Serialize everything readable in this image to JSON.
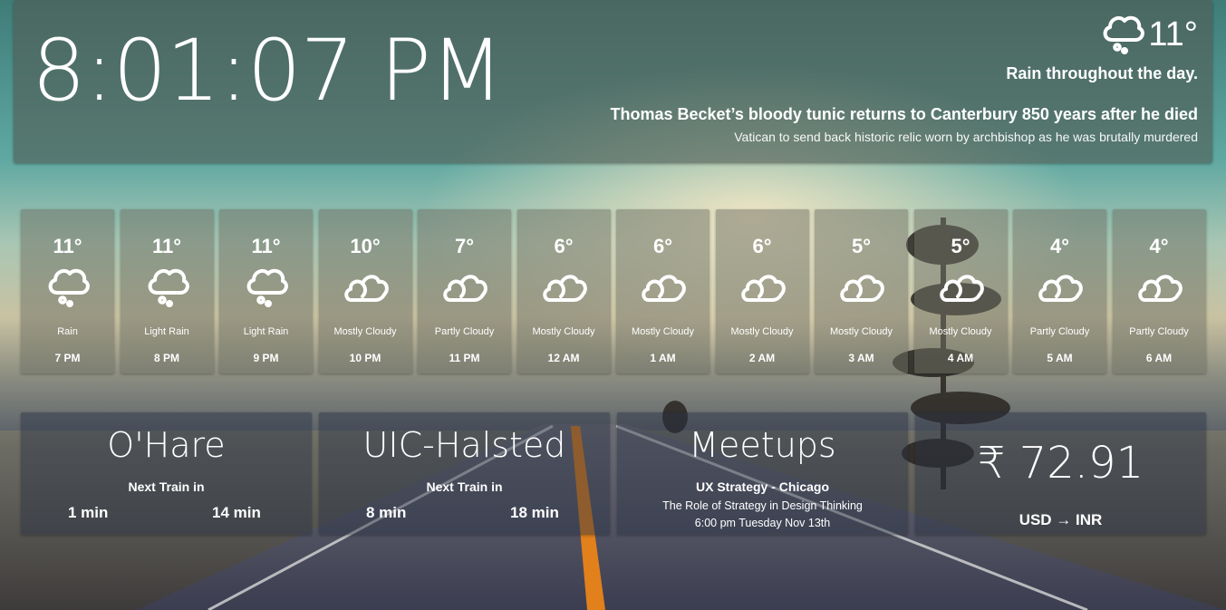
{
  "clock": {
    "time": "8:01:07 PM"
  },
  "current_weather": {
    "icon": "rain-cloud-icon",
    "temp": "11°",
    "summary": "Rain throughout the day."
  },
  "news": {
    "headline": "Thomas Becket’s bloody tunic returns to Canterbury 850 years after he died",
    "subhead": "Vatican to send back historic relic worn by archbishop as he was brutally murdered"
  },
  "hourly": [
    {
      "temp": "11°",
      "condition": "Rain",
      "hour": "7 PM",
      "icon": "rain-cloud-icon"
    },
    {
      "temp": "11°",
      "condition": "Light Rain",
      "hour": "8 PM",
      "icon": "rain-cloud-icon"
    },
    {
      "temp": "11°",
      "condition": "Light Rain",
      "hour": "9 PM",
      "icon": "rain-cloud-icon"
    },
    {
      "temp": "10°",
      "condition": "Mostly Cloudy",
      "hour": "10 PM",
      "icon": "cloudy-icon"
    },
    {
      "temp": "7°",
      "condition": "Partly Cloudy",
      "hour": "11 PM",
      "icon": "cloudy-icon"
    },
    {
      "temp": "6°",
      "condition": "Mostly Cloudy",
      "hour": "12 AM",
      "icon": "cloudy-icon"
    },
    {
      "temp": "6°",
      "condition": "Mostly Cloudy",
      "hour": "1 AM",
      "icon": "cloudy-icon"
    },
    {
      "temp": "6°",
      "condition": "Mostly Cloudy",
      "hour": "2 AM",
      "icon": "cloudy-icon"
    },
    {
      "temp": "5°",
      "condition": "Mostly Cloudy",
      "hour": "3 AM",
      "icon": "cloudy-icon"
    },
    {
      "temp": "5°",
      "condition": "Mostly Cloudy",
      "hour": "4 AM",
      "icon": "cloudy-icon"
    },
    {
      "temp": "4°",
      "condition": "Partly Cloudy",
      "hour": "5 AM",
      "icon": "cloudy-icon"
    },
    {
      "temp": "4°",
      "condition": "Partly Cloudy",
      "hour": "6 AM",
      "icon": "cloudy-icon"
    }
  ],
  "trains": [
    {
      "station": "O'Hare",
      "label": "Next Train in",
      "next1": "1 min",
      "next2": "14 min"
    },
    {
      "station": "UIC-Halsted",
      "label": "Next Train in",
      "next1": "8 min",
      "next2": "18 min"
    }
  ],
  "meetups": {
    "title": "Meetups",
    "name": "UX Strategy - Chicago",
    "topic": "The Role of Strategy in Design Thinking",
    "when": "6:00 pm Tuesday Nov 13th"
  },
  "currency": {
    "rate": "₹ 72.91",
    "pair": "USD → INR"
  }
}
